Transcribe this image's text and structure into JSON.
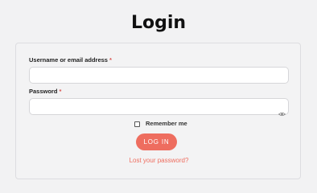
{
  "page": {
    "title": "Login"
  },
  "form": {
    "username": {
      "label": "Username or email address",
      "required_mark": "*",
      "value": ""
    },
    "password": {
      "label": "Password",
      "required_mark": "*",
      "value": "",
      "toggle_icon": "eye-icon"
    },
    "remember_me": {
      "label": "Remember me",
      "checked": false
    },
    "submit_label": "LOG IN",
    "lost_password_link": "Lost your password?"
  },
  "colors": {
    "accent": "#ee6d5f",
    "required": "#d9534f",
    "background": "#f2f2f3"
  }
}
